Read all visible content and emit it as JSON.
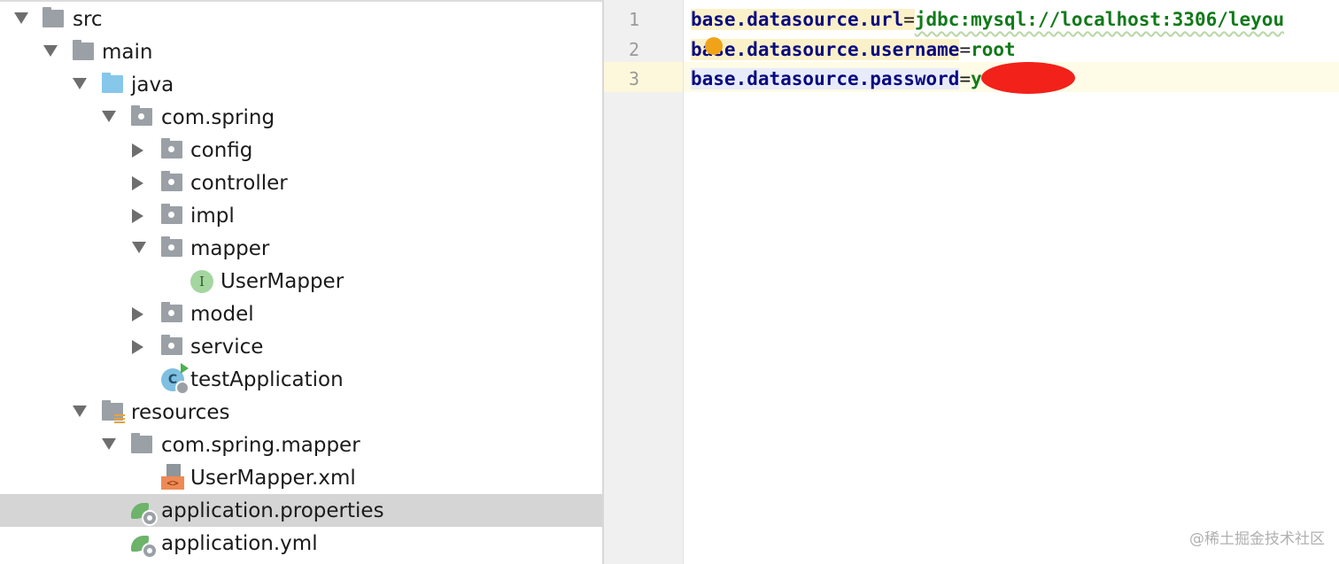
{
  "tree": {
    "items": [
      {
        "label": "src",
        "icon": "source-folder-icon",
        "expanded": true
      },
      {
        "label": "main",
        "icon": "folder-icon",
        "expanded": true
      },
      {
        "label": "java",
        "icon": "source-root-folder-icon",
        "expanded": true
      },
      {
        "label": "com.spring",
        "icon": "package-icon",
        "expanded": true
      },
      {
        "label": "config",
        "icon": "package-icon",
        "expanded": false
      },
      {
        "label": "controller",
        "icon": "package-icon",
        "expanded": false
      },
      {
        "label": "impl",
        "icon": "package-icon",
        "expanded": false
      },
      {
        "label": "mapper",
        "icon": "package-icon",
        "expanded": true
      },
      {
        "label": "UserMapper",
        "icon": "interface-icon",
        "badge": "I"
      },
      {
        "label": "model",
        "icon": "package-icon",
        "expanded": false
      },
      {
        "label": "service",
        "icon": "package-icon",
        "expanded": false
      },
      {
        "label": "testApplication",
        "icon": "spring-boot-app-icon",
        "badge": "C"
      },
      {
        "label": "resources",
        "icon": "resources-folder-icon",
        "expanded": true
      },
      {
        "label": "com.spring.mapper",
        "icon": "folder-icon",
        "expanded": true
      },
      {
        "label": "UserMapper.xml",
        "icon": "xml-file-icon",
        "badge": "<>"
      },
      {
        "label": "application.properties",
        "icon": "spring-properties-icon",
        "selected": true
      },
      {
        "label": "application.yml",
        "icon": "spring-yml-icon"
      }
    ]
  },
  "editor": {
    "line_numbers": [
      "1",
      "2",
      "3"
    ],
    "current_line": 3,
    "lines": [
      {
        "key": "base.datasource.url",
        "eq": "=",
        "value": "jdbc:mysql://localhost:3306/leyou"
      },
      {
        "key": "base.datasource.username",
        "eq": "=",
        "value": "root"
      },
      {
        "key": "base.datasource.password",
        "eq": "=",
        "value": "y"
      }
    ]
  },
  "watermark": "@稀土掘金技术社区",
  "colors": {
    "key": "#0a0a80",
    "value": "#117a1a",
    "selected_row": "#d5d5d5",
    "current_line": "#fefbe6",
    "redaction": "#f2211a"
  }
}
